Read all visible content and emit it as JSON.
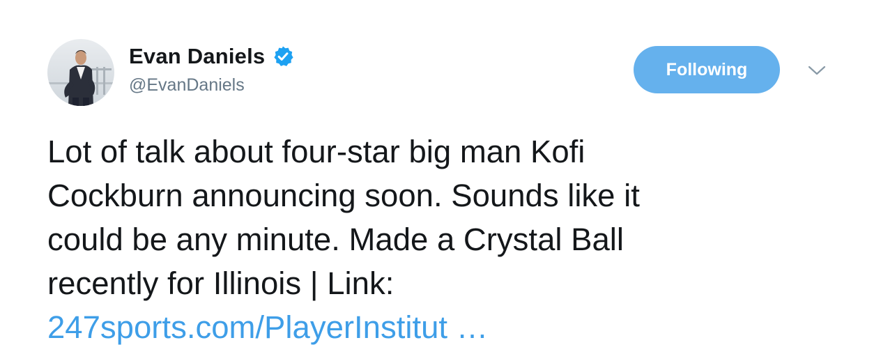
{
  "author": {
    "display_name": "Evan Daniels",
    "handle": "@EvanDaniels",
    "verified": true,
    "avatar_icon": "user-photo"
  },
  "actions": {
    "follow_label": "Following",
    "caret_icon": "chevron-down-icon"
  },
  "tweet": {
    "lines": [
      "Lot of talk about four-star big man Kofi",
      "Cockburn announcing soon. Sounds like it",
      "could be any minute. Made a Crystal Ball",
      "recently for Illinois | Link:"
    ],
    "link_text": "247sports.com/PlayerInstitut …"
  },
  "colors": {
    "follow_button": "#65b1ed",
    "link": "#3e9ee8",
    "verified_badge": "#1da1f2",
    "handle": "#657786",
    "text": "#14171a"
  }
}
